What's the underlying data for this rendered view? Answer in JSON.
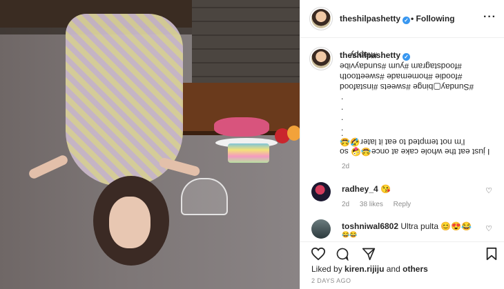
{
  "post": {
    "username": "theshilpashetty",
    "verified_glyph": "✓",
    "follow_separator": "•",
    "follow_status": "Following",
    "more_glyph": "···"
  },
  "caption": {
    "username": "theshilpashetty",
    "lines_flipped": [
      "#happy",
      "#foodstagram #yum #sundayvibe",
      "#foodie #homemade #sweettooth",
      "#Sunday▢binge #sweets #instafood"
    ],
    "dots": [
      ".",
      ".",
      ".",
      ".",
      "."
    ],
    "lines_flipped_2": [
      "I'm not tempted to eat it later🤣😂",
      "I just eat the whole cake at once😂🤪 so"
    ],
    "time": "2d"
  },
  "comments": [
    {
      "user": "radhey_4",
      "text": "😘",
      "time": "2d",
      "likes": "38 likes",
      "reply": "Reply"
    },
    {
      "user": "toshniwal6802",
      "text": "Ultra pulta 😊😍😂",
      "text2": "😂😂"
    }
  ],
  "actions": {
    "like_icon": "heart-outline",
    "comment_icon": "speech-bubble",
    "share_icon": "paper-plane",
    "save_icon": "bookmark"
  },
  "likes": {
    "prefix": "Liked by",
    "user": "kiren.rijiju",
    "and": "and",
    "others": "others"
  },
  "timestamp": "2 DAYS AGO"
}
